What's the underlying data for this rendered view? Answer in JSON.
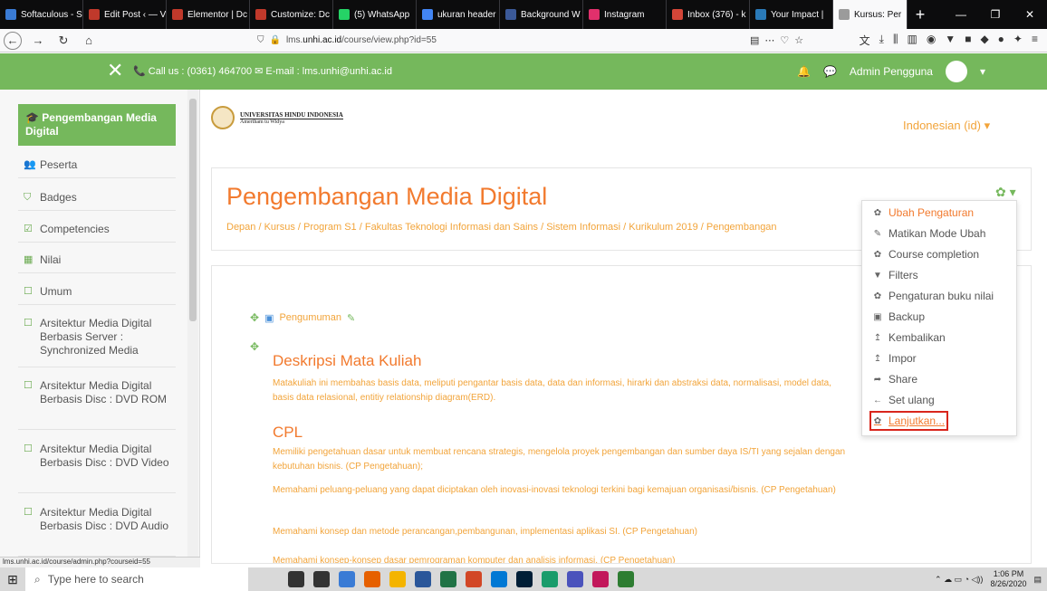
{
  "browser": {
    "tabs": [
      {
        "label": "Softaculous - S",
        "color": "#3a7bd5"
      },
      {
        "label": "Edit Post ‹ — V",
        "color": "#c0392b"
      },
      {
        "label": "Elementor | Dc",
        "color": "#c0392b"
      },
      {
        "label": "Customize: Dc",
        "color": "#c0392b"
      },
      {
        "label": "(5) WhatsApp",
        "color": "#25d366"
      },
      {
        "label": "ukuran header",
        "color": "#4285f4"
      },
      {
        "label": "Background W",
        "color": "#3b5998"
      },
      {
        "label": "Instagram",
        "color": "#e1306c"
      },
      {
        "label": "Inbox (376) - k",
        "color": "#d44638"
      },
      {
        "label": "Your Impact | ",
        "color": "#2a7ab8"
      },
      {
        "label": "Kursus: Per",
        "color": "#9b9b9b"
      }
    ],
    "active_tab_index": 10,
    "new_tab": "+",
    "url_prefix": "lms.",
    "url_domain": "unhi.ac.id",
    "url_path": "/course/view.php?id=55",
    "status_url": "lms.unhi.ac.id/course/admin.php?courseid=55"
  },
  "topbar": {
    "close": "✕",
    "contact": "📞 Call us : (0361) 464700 ✉ E-mail : lms.unhi@unhi.ac.id",
    "user": "Admin Pengguna"
  },
  "sidebar": {
    "course": "Pengembangan Media Digital",
    "items": [
      {
        "label": "Peserta",
        "icon": "users-icon",
        "glyph": "👥"
      },
      {
        "label": "Badges",
        "icon": "shield-icon",
        "glyph": "⛉"
      },
      {
        "label": "Competencies",
        "icon": "checkbox-icon",
        "glyph": "☑"
      },
      {
        "label": "Nilai",
        "icon": "table-icon",
        "glyph": "▦"
      },
      {
        "label": "Umum",
        "icon": "folder-icon",
        "glyph": "☐"
      },
      {
        "label": "Arsitektur Media Digital Berbasis Server : Synchronized Media",
        "icon": "folder-icon",
        "glyph": "☐"
      },
      {
        "label": "Arsitektur Media Digital Berbasis Disc : DVD ROM",
        "icon": "folder-icon",
        "glyph": "☐"
      },
      {
        "label": "Arsitektur Media Digital Berbasis Disc : DVD Video",
        "icon": "folder-icon",
        "glyph": "☐"
      },
      {
        "label": "Arsitektur Media Digital Berbasis Disc : DVD Audio",
        "icon": "folder-icon",
        "glyph": "☐"
      }
    ]
  },
  "header": {
    "univ": "UNIVERSITAS HINDU INDONESIA",
    "motto": "Amertham tu Widya",
    "language": "Indonesian (id) ▾"
  },
  "course": {
    "title": "Pengembangan Media Digital",
    "breadcrumb": "Depan  /  Kursus  /  Program S1  /  Fakultas Teknologi Informasi dan Sains  /  Sistem Informasi  /  Kurikulum 2019  /  Pengembangan"
  },
  "content": {
    "announcement": "Pengumuman",
    "desc_title": "Deskripsi Mata Kuliah",
    "desc_text": "Matakuliah ini membahas basis data, meliputi pengantar basis data, data dan informasi, hirarki dan abstraksi data, normalisasi, model data, basis data relasional, entitiy relationship diagram(ERD).",
    "cpl_title": "CPL",
    "cpl": [
      "Memiliki pengetahuan dasar untuk membuat rencana strategis, mengelola proyek pengembangan dan sumber daya IS/TI yang sejalan dengan kebutuhan bisnis. (CP Pengetahuan);",
      "Memahami peluang-peluang yang dapat diciptakan oleh inovasi-inovasi teknologi terkini bagi kemajuan organisasi/bisnis. (CP Pengetahuan)",
      "Memahami konsep dan metode perancangan,pembangunan, implementasi aplikasi SI. (CP Pengetahuan)",
      "Memahami konsep-konsep dasar pemrograman komputer dan analisis informasi. (CP Pengetahuan)"
    ]
  },
  "menu": {
    "items": [
      {
        "label": "Ubah Pengaturan",
        "icon": "gear-icon",
        "glyph": "✿"
      },
      {
        "label": "Matikan Mode Ubah",
        "icon": "pencil-icon",
        "glyph": "✎"
      },
      {
        "label": "Course completion",
        "icon": "gear-icon",
        "glyph": "✿"
      },
      {
        "label": "Filters",
        "icon": "filter-icon",
        "glyph": "▼"
      },
      {
        "label": "Pengaturan buku nilai",
        "icon": "gear-icon",
        "glyph": "✿"
      },
      {
        "label": "Backup",
        "icon": "file-icon",
        "glyph": "▣"
      },
      {
        "label": "Kembalikan",
        "icon": "upload-icon",
        "glyph": "↥"
      },
      {
        "label": "Impor",
        "icon": "upload-icon",
        "glyph": "↥"
      },
      {
        "label": "Share",
        "icon": "share-icon",
        "glyph": "➦"
      },
      {
        "label": "Set ulang",
        "icon": "arrow-left-icon",
        "glyph": "←"
      },
      {
        "label": "Lanjutkan...",
        "icon": "gear-icon",
        "glyph": "✿"
      }
    ]
  },
  "taskbar": {
    "search_placeholder": "Type here to search",
    "time": "1:06 PM",
    "date": "8/26/2020",
    "apps": [
      "#333333",
      "#333333",
      "#3a7bd5",
      "#e66000",
      "#f4b400",
      "#2b579a",
      "#217346",
      "#d24726",
      "#0078d4",
      "#001e36",
      "#1a9c6b",
      "#4b53bc",
      "#c2185b",
      "#2e7d32"
    ]
  }
}
